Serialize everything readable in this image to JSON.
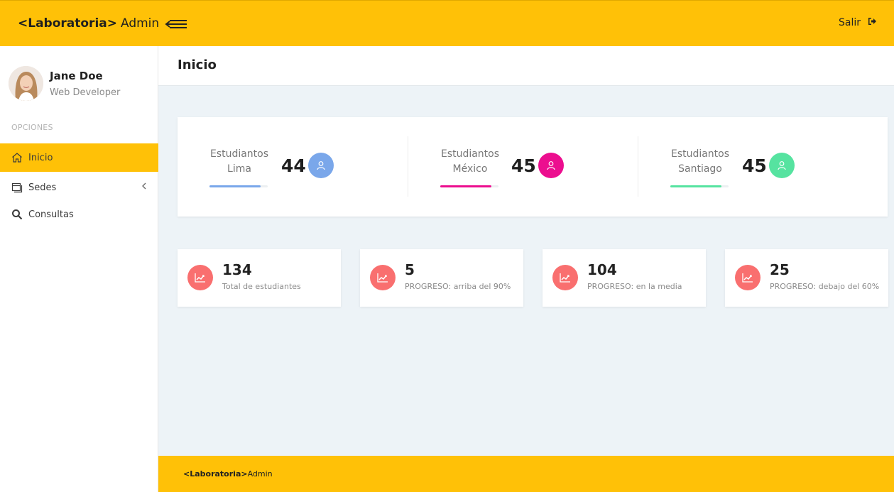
{
  "topbar": {
    "brand_bold": "<Laboratoria>",
    "brand_light": "Admin",
    "logout_label": "Salir",
    "bg_color": "#ffc107"
  },
  "profile": {
    "name": "Jane Doe",
    "role": "Web Developer"
  },
  "sidebar": {
    "section_label": "OPCIONES",
    "items": [
      {
        "label": "Inicio",
        "icon": "home-icon",
        "active": true
      },
      {
        "label": "Sedes",
        "icon": "sedes-icon",
        "active": false
      },
      {
        "label": "Consultas",
        "icon": "search-icon",
        "active": false
      }
    ]
  },
  "page": {
    "title": "Inicio"
  },
  "stats": [
    {
      "label_line1": "Estudiantos",
      "label_line2": "Lima",
      "value": "44",
      "color": "#7aa7ea",
      "progress": 0.88
    },
    {
      "label_line1": "Estudiantos",
      "label_line2": "México",
      "value": "45",
      "color": "#ec0e8f",
      "progress": 0.88
    },
    {
      "label_line1": "Estudiantos",
      "label_line2": "Santiago",
      "value": "45",
      "color": "#56e3a0",
      "progress": 0.88
    }
  ],
  "cards": [
    {
      "value": "134",
      "caption": "Total de estudiantes"
    },
    {
      "value": "5",
      "caption": "PROGRESO: arriba del 90%"
    },
    {
      "value": "104",
      "caption": "PROGRESO: en la media"
    },
    {
      "value": "25",
      "caption": "PROGRESO: debajo del 60%"
    }
  ],
  "footer": {
    "brand_bold": "<Laboratoria>",
    "brand_light": "Admin"
  }
}
